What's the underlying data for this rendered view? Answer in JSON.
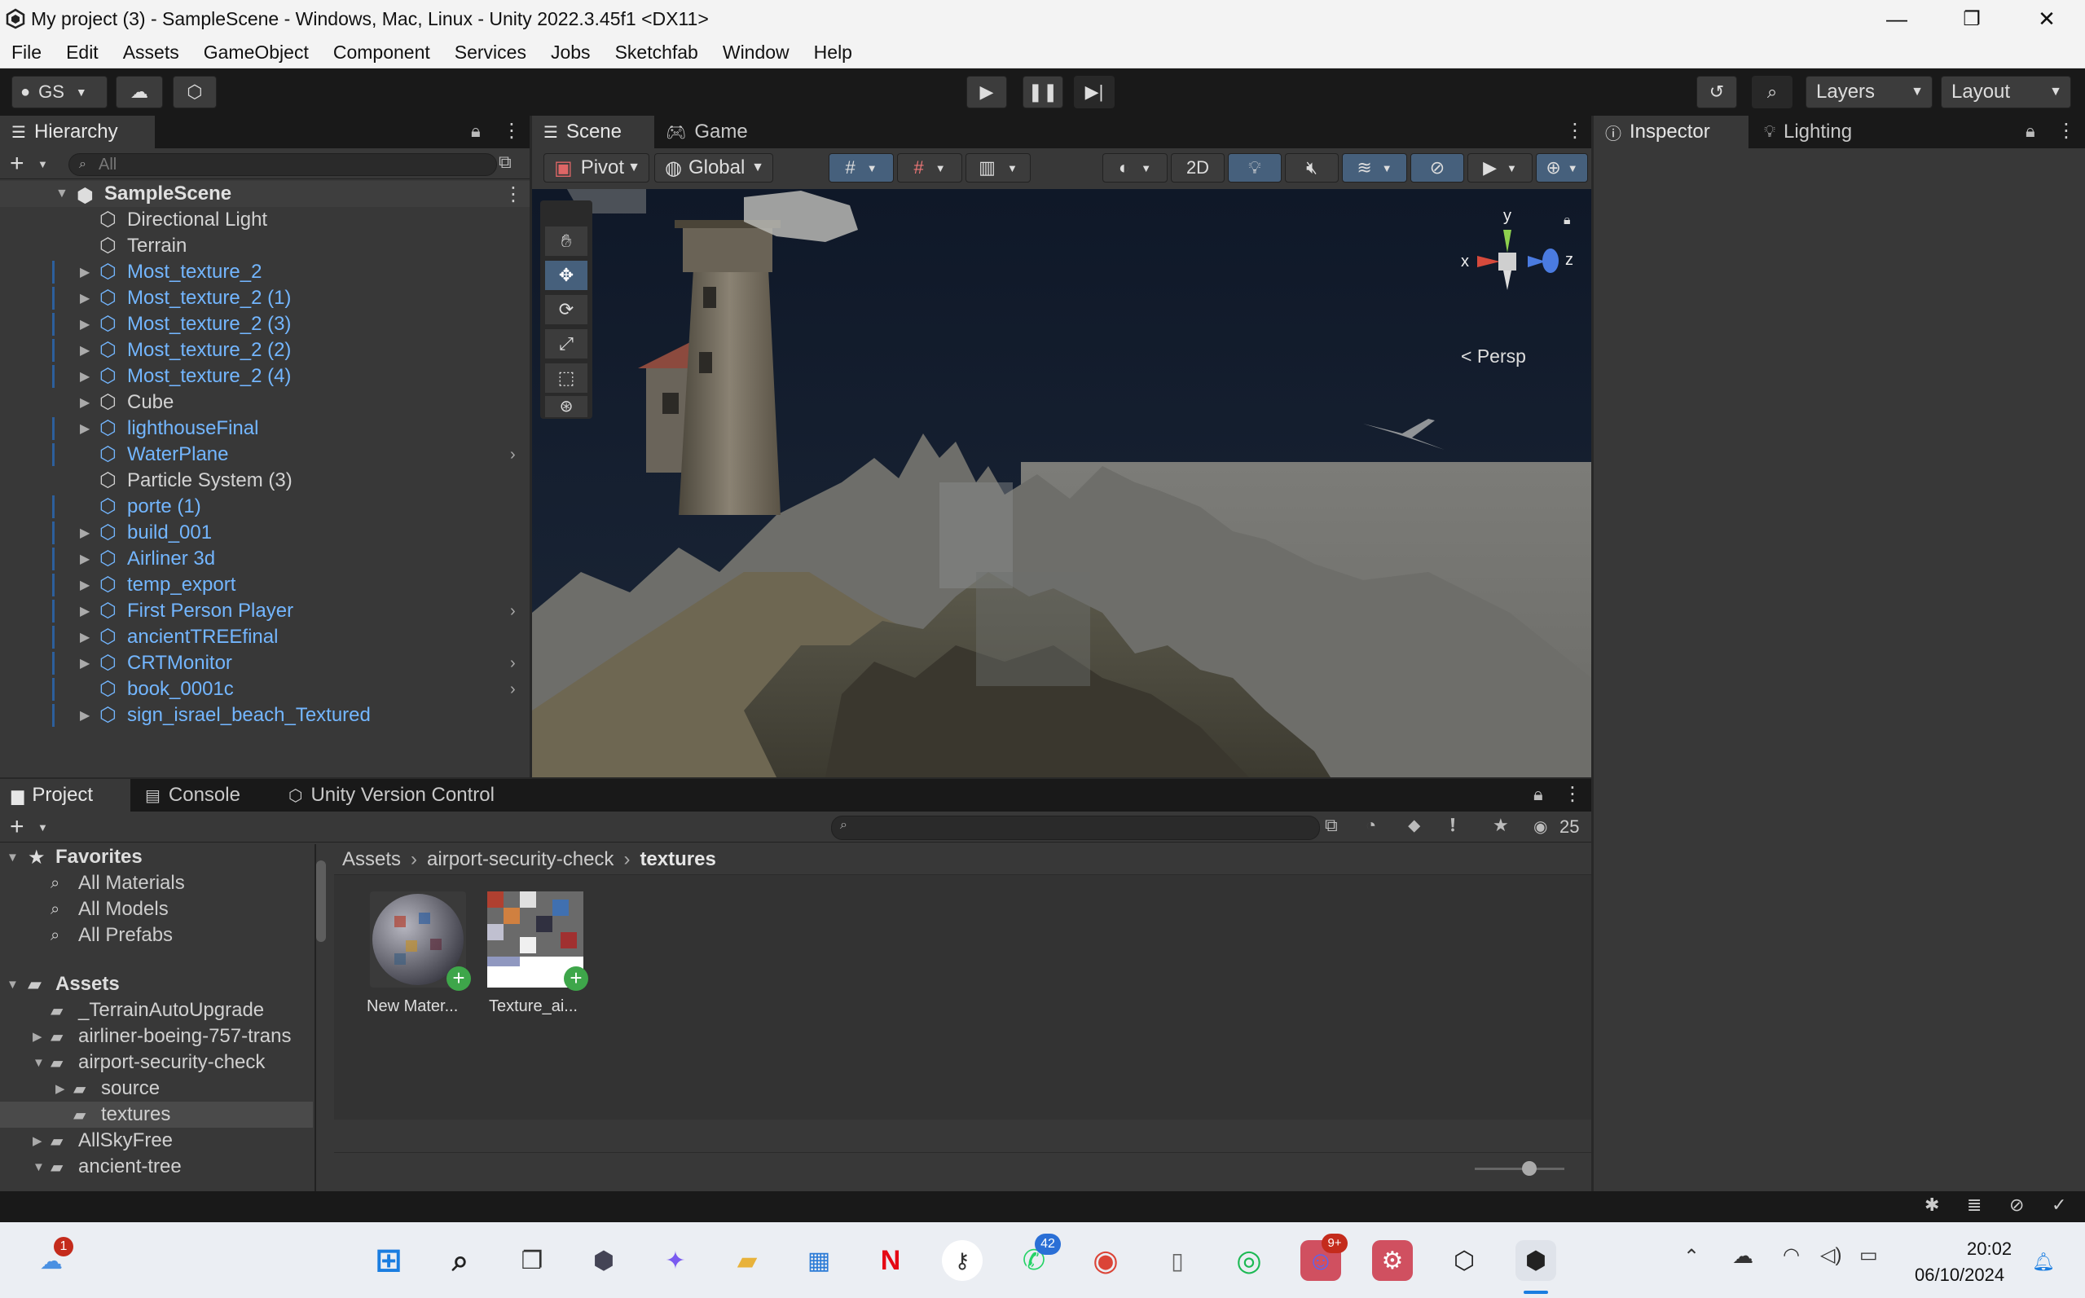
{
  "window": {
    "title": "My project (3) - SampleScene - Windows, Mac, Linux - Unity 2022.3.45f1 <DX11>",
    "minimize": "—",
    "maximize": "❐",
    "close": "✕"
  },
  "menu": [
    "File",
    "Edit",
    "Assets",
    "GameObject",
    "Component",
    "Services",
    "Jobs",
    "Sketchfab",
    "Window",
    "Help"
  ],
  "toolbar": {
    "account": "GS",
    "layers": "Layers",
    "layout": "Layout"
  },
  "hierarchy": {
    "tab": "Hierarchy",
    "search_placeholder": "All",
    "scene_name": "SampleScene",
    "items": [
      {
        "label": "Directional Light",
        "prefab": false,
        "expandable": false
      },
      {
        "label": "Terrain",
        "prefab": false,
        "expandable": false
      },
      {
        "label": "Most_texture_2",
        "prefab": true,
        "expandable": true
      },
      {
        "label": "Most_texture_2 (1)",
        "prefab": true,
        "expandable": true
      },
      {
        "label": "Most_texture_2 (3)",
        "prefab": true,
        "expandable": true
      },
      {
        "label": "Most_texture_2 (2)",
        "prefab": true,
        "expandable": true
      },
      {
        "label": "Most_texture_2 (4)",
        "prefab": true,
        "expandable": true
      },
      {
        "label": "Cube",
        "prefab": false,
        "expandable": true
      },
      {
        "label": "lighthouseFinal",
        "prefab": true,
        "expandable": true
      },
      {
        "label": "WaterPlane",
        "prefab": true,
        "expandable": false
      },
      {
        "label": "Particle System (3)",
        "prefab": false,
        "expandable": false
      },
      {
        "label": "porte (1)",
        "prefab": true,
        "expandable": false
      },
      {
        "label": "build_001",
        "prefab": true,
        "expandable": true
      },
      {
        "label": "Airliner 3d",
        "prefab": true,
        "expandable": true
      },
      {
        "label": "temp_export",
        "prefab": true,
        "expandable": true
      },
      {
        "label": "First Person Player",
        "prefab": true,
        "expandable": true
      },
      {
        "label": "ancientTREEfinal",
        "prefab": true,
        "expandable": true
      },
      {
        "label": "CRTMonitor",
        "prefab": true,
        "expandable": true
      },
      {
        "label": "book_0001c",
        "prefab": true,
        "expandable": false
      },
      {
        "label": "sign_israel_beach_Textured",
        "prefab": true,
        "expandable": true
      }
    ]
  },
  "scene": {
    "tab_scene": "Scene",
    "tab_game": "Game",
    "pivot": "Pivot",
    "global": "Global",
    "two_d": "2D",
    "persp": "Persp",
    "axis_x": "x",
    "axis_y": "y",
    "axis_z": "z"
  },
  "inspector": {
    "tab_inspector": "Inspector",
    "tab_lighting": "Lighting"
  },
  "project": {
    "tab_project": "Project",
    "tab_console": "Console",
    "tab_vc": "Unity Version Control",
    "hidden_count": "25",
    "breadcrumb": [
      "Assets",
      "airport-security-check",
      "textures"
    ],
    "favorites_label": "Favorites",
    "favorites": [
      "All Materials",
      "All Models",
      "All Prefabs"
    ],
    "assets_label": "Assets",
    "tree": [
      {
        "label": "_TerrainAutoUpgrade",
        "depth": 1,
        "expandable": false
      },
      {
        "label": "airliner-boeing-757-trans",
        "depth": 1,
        "expandable": true
      },
      {
        "label": "airport-security-check",
        "depth": 1,
        "expandable": true,
        "open": true
      },
      {
        "label": "source",
        "depth": 2,
        "expandable": true
      },
      {
        "label": "textures",
        "depth": 2,
        "expandable": false,
        "selected": true
      },
      {
        "label": "AllSkyFree",
        "depth": 1,
        "expandable": true
      },
      {
        "label": "ancient-tree",
        "depth": 1,
        "expandable": true,
        "open": true
      }
    ],
    "assets": [
      {
        "label": "New Mater...",
        "kind": "material"
      },
      {
        "label": "Texture_ai...",
        "kind": "texture"
      }
    ]
  },
  "taskbar": {
    "time": "20:02",
    "date": "06/10/2024",
    "weather_badge": "1",
    "whatsapp_badge": "42",
    "discord_badge": "9+"
  }
}
